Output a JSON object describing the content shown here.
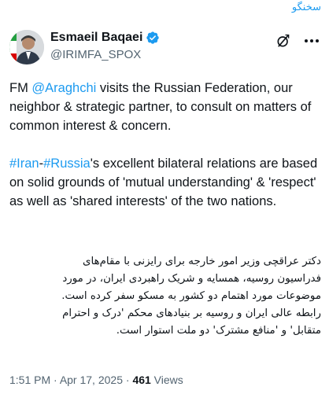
{
  "page_label": "سخنگو",
  "user": {
    "name": "Esmaeil Baqaei",
    "handle": "@IRIMFA_SPOX",
    "verified_color": "#1d9bf0"
  },
  "icons": [
    "grok-icon",
    "more-icon",
    "verified-icon"
  ],
  "tweet": {
    "para1": {
      "prefix": "FM ",
      "mention": "@Araghchi",
      "rest": " visits the Russian Federation, our neighbor & strategic partner, to consult on matters of common interest & concern."
    },
    "para2": {
      "tag1": "#Iran",
      "sep": "-",
      "tag2": "#Russia",
      "rest": "'s excellent bilateral relations are based on solid grounds of 'mutual understanding' & 'respect' as well as 'shared interests' of the two nations."
    },
    "persian_lines": [
      "دکتر عراقچی وزیر امور خارجه برای رایزنی با مقام‌های",
      "فدراسیون روسیه، همسایه و شریک راهبردی ایران، در مورد",
      "موضوعات مورد اهتمام دو کشور به مسکو سفر کرده است.",
      "رابطه عالی ایران و روسیه بر بنیادهای محکم 'درک و احترام",
      "متقابل' و 'منافع مشترک' دو ملت استوار است."
    ]
  },
  "meta": {
    "time": "1:51 PM",
    "dot": " · ",
    "date": "Apr 17, 2025",
    "dot2": " · ",
    "views_count": "461",
    "views_label": " Views"
  },
  "colors": {
    "link": "#1d9bf0",
    "text": "#0f1419",
    "secondary": "#536471"
  }
}
